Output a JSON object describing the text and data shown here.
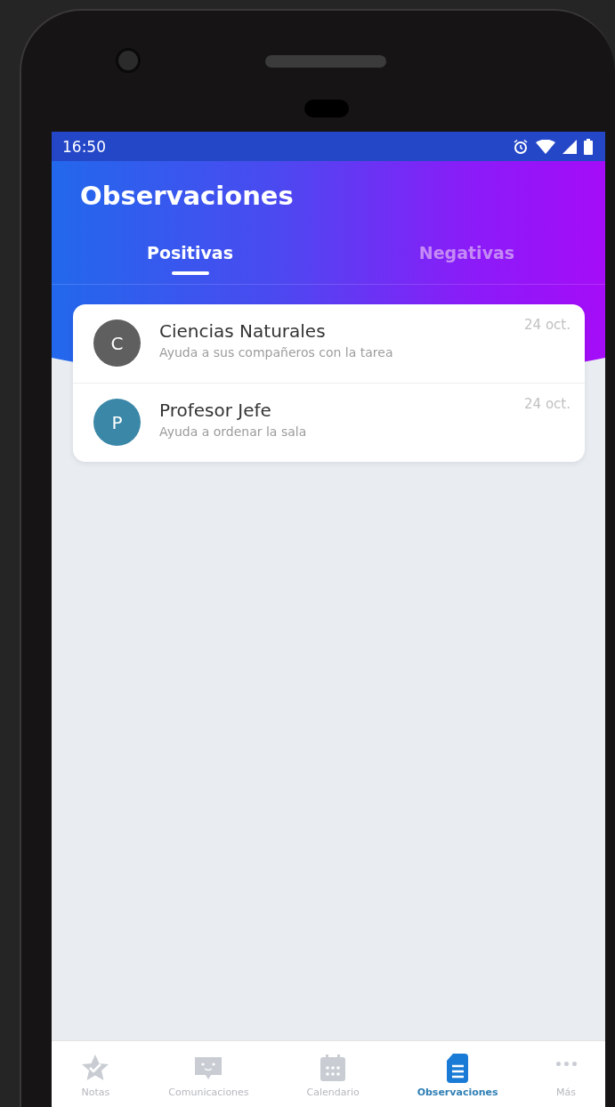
{
  "status_bar": {
    "time": "16:50"
  },
  "header": {
    "title": "Observaciones"
  },
  "tabs": [
    {
      "label": "Positivas",
      "selected": true
    },
    {
      "label": "Negativas",
      "selected": false
    }
  ],
  "observations": [
    {
      "initial": "C",
      "color": "#5f5f5f",
      "subject": "Ciencias Naturales",
      "description": "Ayuda a sus compañeros con la tarea",
      "date": "24 oct."
    },
    {
      "initial": "P",
      "color": "#3a87a8",
      "subject": "Profesor Jefe",
      "description": "Ayuda a ordenar la sala",
      "date": "24 oct."
    }
  ],
  "bottom_nav": [
    {
      "kind": "star",
      "label": "Notas",
      "selected": false
    },
    {
      "kind": "chat",
      "label": "Comunicaciones",
      "selected": false
    },
    {
      "kind": "calendar",
      "label": "Calendario",
      "selected": false
    },
    {
      "kind": "document",
      "label": "Observaciones",
      "selected": true
    },
    {
      "kind": "more",
      "label": "Más",
      "selected": false
    }
  ]
}
